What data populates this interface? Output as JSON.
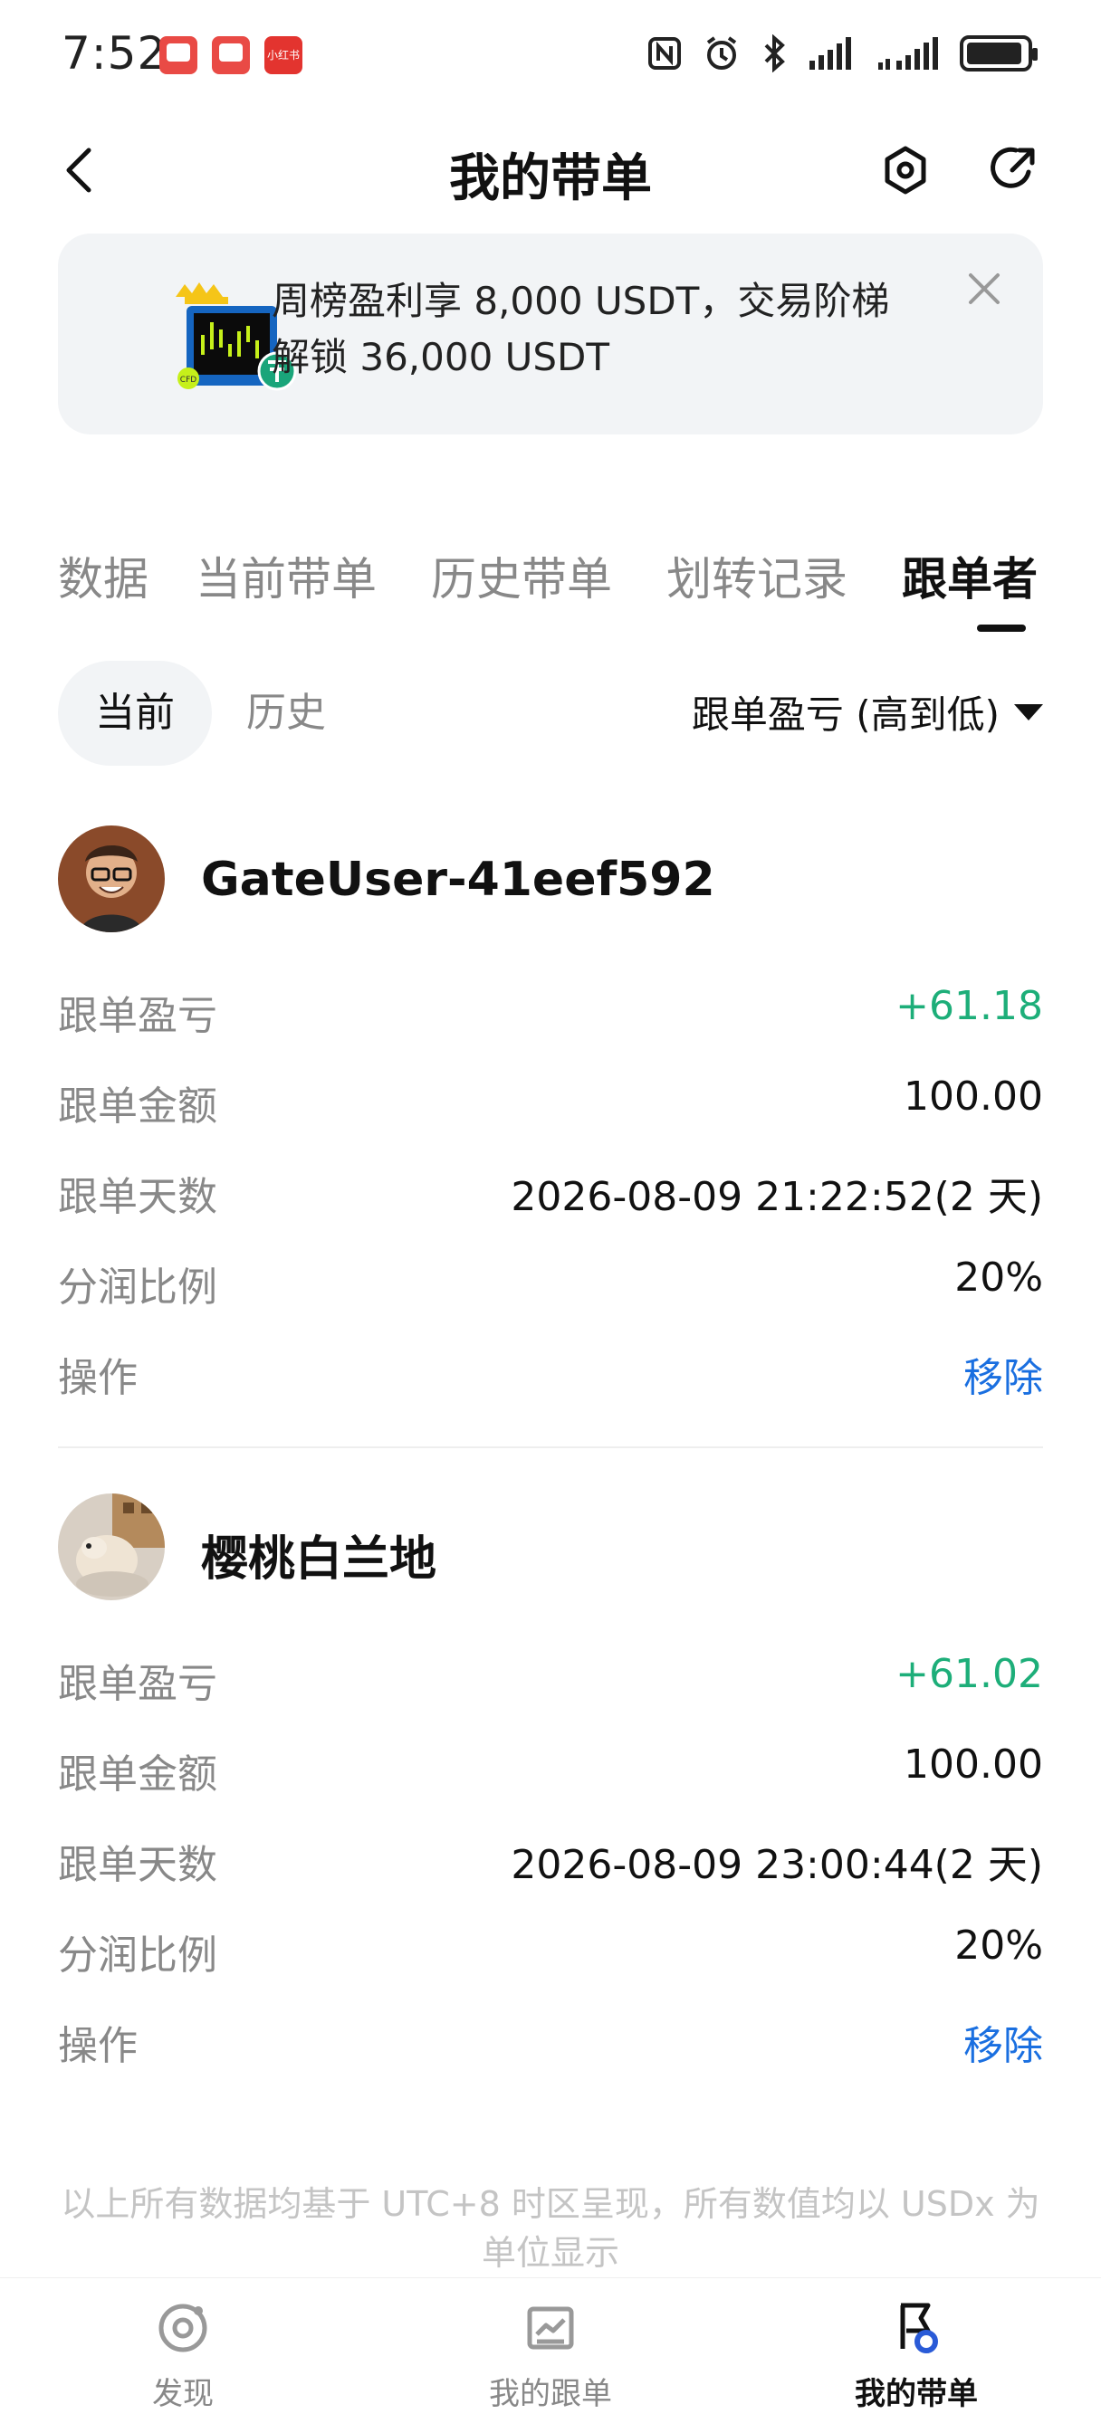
{
  "status_bar": {
    "time": "7:52",
    "app_badges": [
      "app-badge-1",
      "app-badge-2",
      "小红书"
    ]
  },
  "header": {
    "title": "我的带单",
    "back_icon": "chevron-left-icon",
    "settings_icon": "hexagon-settings-icon",
    "share_icon": "share-icon"
  },
  "banner": {
    "line1": "周榜盈利享 8,000 USDT，交易阶梯",
    "line2": "解锁 36,000 USDT",
    "close_icon": "close-icon"
  },
  "tabs": [
    {
      "label": "数据",
      "active": false
    },
    {
      "label": "当前带单",
      "active": false
    },
    {
      "label": "历史带单",
      "active": false
    },
    {
      "label": "划转记录",
      "active": false
    },
    {
      "label": "跟单者",
      "active": true
    }
  ],
  "filters": {
    "current": "当前",
    "history": "历史",
    "sort": "跟单盈亏 (高到低)"
  },
  "followers": [
    {
      "name": "GateUser-41eef592",
      "rows": [
        {
          "label": "跟单盈亏",
          "value": "+61.18"
        },
        {
          "label": "跟单金额",
          "value": "100.00"
        },
        {
          "label": "跟单天数",
          "value": "2026-08-09 21:22:52(2 天)"
        },
        {
          "label": "分润比例",
          "value": "20%"
        },
        {
          "label": "操作",
          "value": "移除"
        }
      ]
    },
    {
      "name": "樱桃白兰地",
      "rows": [
        {
          "label": "跟单盈亏",
          "value": "+61.02"
        },
        {
          "label": "跟单金额",
          "value": "100.00"
        },
        {
          "label": "跟单天数",
          "value": "2026-08-09 23:00:44(2 天)"
        },
        {
          "label": "分润比例",
          "value": "20%"
        },
        {
          "label": "操作",
          "value": "移除"
        }
      ]
    }
  ],
  "footnote": {
    "line1": "以上所有数据均基于 UTC+8 时区呈现，所有数值均以 USDx 为",
    "line2": "单位显示"
  },
  "bottom_nav": [
    {
      "label": "发现",
      "icon": "discover-icon",
      "active": false
    },
    {
      "label": "我的跟单",
      "icon": "chart-board-icon",
      "active": false
    },
    {
      "label": "我的带单",
      "icon": "flag-icon",
      "active": true
    }
  ],
  "colors": {
    "profit_green": "#1dae79",
    "link_blue": "#1a6fe0",
    "muted": "#888888"
  }
}
